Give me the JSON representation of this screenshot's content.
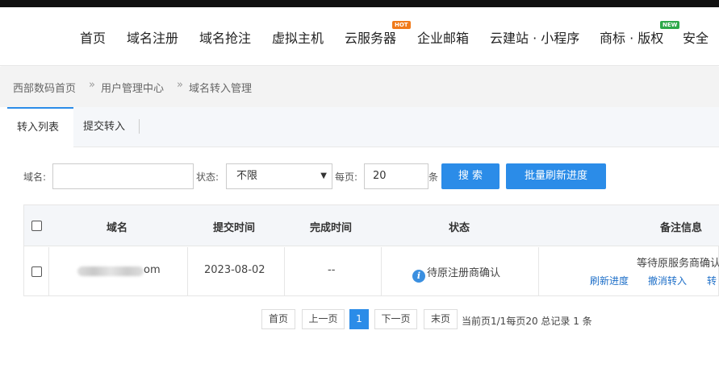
{
  "nav": {
    "items": [
      {
        "label": "首页"
      },
      {
        "label": "域名注册"
      },
      {
        "label": "域名抢注"
      },
      {
        "label": "虚拟主机"
      },
      {
        "label": "云服务器",
        "badge": "HOT"
      },
      {
        "label": "企业邮箱"
      },
      {
        "label": "云建站 · 小程序"
      },
      {
        "label": "商标 · 版权",
        "badge": "NEW"
      },
      {
        "label": "安全"
      }
    ]
  },
  "breadcrumb": {
    "items": [
      "西部数码首页",
      "用户管理中心",
      "域名转入管理"
    ],
    "separator": "»"
  },
  "tabs": {
    "items": [
      "转入列表",
      "提交转入"
    ],
    "active_index": 0
  },
  "filters": {
    "domain_label": "域名:",
    "domain_value": "",
    "status_label": "状态:",
    "status_value": "不限",
    "perpage_label": "每页:",
    "perpage_value": "20",
    "perpage_unit": "条",
    "search_button": "搜 索",
    "batch_refresh_button": "批量刷新进度"
  },
  "table": {
    "headers": [
      "域名",
      "提交时间",
      "完成时间",
      "状态",
      "备注信息"
    ],
    "rows": [
      {
        "domain_visible": "om",
        "submit_time": "2023-08-02",
        "complete_time": "--",
        "status": "待原注册商确认",
        "remark": "等待原服务商确认",
        "actions": [
          "刷新进度",
          "撤消转入",
          "转"
        ]
      }
    ]
  },
  "pagination": {
    "first": "首页",
    "prev": "上一页",
    "current_page": "1",
    "next": "下一页",
    "last": "末页",
    "info": "当前页1/1每页20 总记录 1 条"
  },
  "colors": {
    "accent": "#2b8ce8",
    "link": "#1e6fc8",
    "hot_badge": "#f07a1a",
    "new_badge": "#2ea84a"
  }
}
